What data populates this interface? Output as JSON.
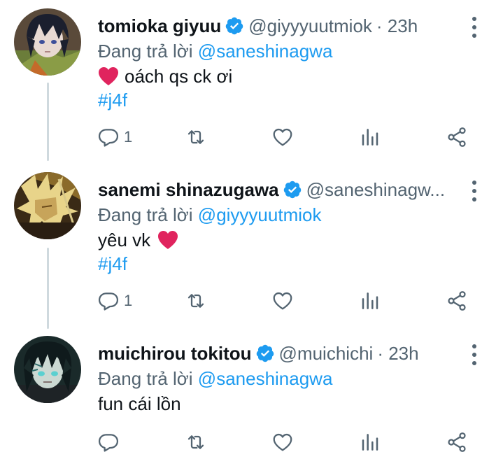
{
  "reply_prefix": "Đang trả lời",
  "colors": {
    "accent": "#1d9bf0",
    "muted": "#536471",
    "text": "#0f1419",
    "heart": "#e0245e",
    "thread_line": "#cfd9de"
  },
  "tweets": [
    {
      "name": "tomioka giyuu",
      "handle": "@giyyyuutmiok",
      "time": "· 23h",
      "reply_to": "@saneshinagwa",
      "text": "oách qs ck ơi",
      "hashtag": "#j4f",
      "reply_count": "1",
      "emoji": "red-heart"
    },
    {
      "name": "sanemi shinazugawa",
      "handle": "@saneshinagw...",
      "time": "",
      "reply_to": "@giyyyuutmiok",
      "text": "yêu vk",
      "hashtag": "#j4f",
      "reply_count": "1",
      "emoji": "red-heart"
    },
    {
      "name": "muichirou tokitou",
      "handle": "@muichichi",
      "time": "· 23h",
      "reply_to": "@saneshinagwa",
      "text": "fun cái lồn",
      "hashtag": "",
      "reply_count": "",
      "emoji": ""
    }
  ],
  "icons": [
    "reply-icon",
    "retweet-icon",
    "like-icon",
    "analytics-icon",
    "share-icon",
    "verified-badge-icon",
    "more-options-icon"
  ]
}
